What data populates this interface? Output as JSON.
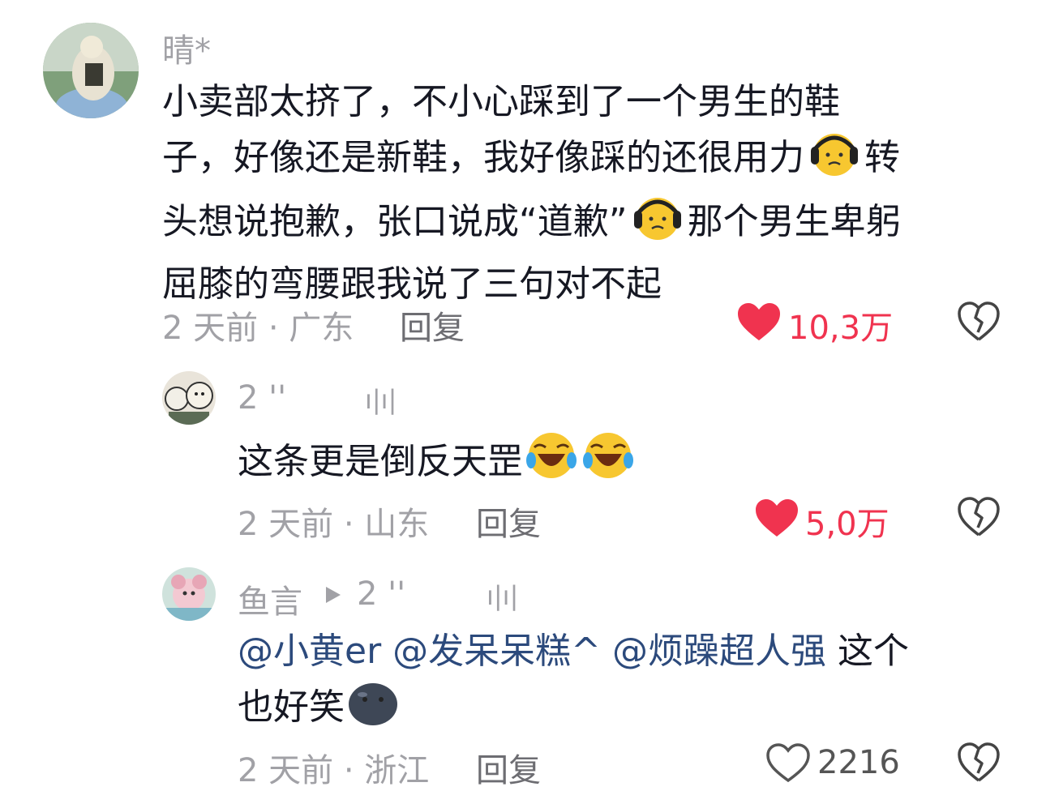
{
  "colors": {
    "like_active": "#f0334f",
    "meta": "#a1a1a6",
    "mention": "#2c4a7c",
    "text": "#161823"
  },
  "comment1": {
    "username": "晴*",
    "lines": [
      "小卖部太挤了，不小心踩到了一个男生的鞋",
      "子，好像还是新鞋，我好像踩的还很用力",
      "转",
      "头想说抱歉，张口说成“道歉”",
      "那个男生卑躬",
      "屈膝的弯腰跟我说了三句对不起"
    ],
    "meta": "2 天前 · 广东",
    "reply": "回复",
    "likes": "10,3万",
    "liked": true
  },
  "comment2": {
    "username": "2 ''",
    "author_tag": "ı|ı|",
    "text": "这条更是倒反天罡",
    "meta": "2 天前 · 山东",
    "reply": "回复",
    "likes": "5,0万",
    "liked": true
  },
  "comment3": {
    "username": "鱼言",
    "reply_to": "2 ''",
    "author_tag": "ı|ı|",
    "mentions": [
      "@小黄er",
      "@发呆呆糕^",
      "@烦躁超人强"
    ],
    "text_line1_tail": "这个",
    "text_line2": "也好笑",
    "meta": "2 天前 · 浙江",
    "reply": "回复",
    "likes": "2216",
    "liked": false
  },
  "icons": [
    "heart-icon",
    "dislike-icon",
    "triangle-arrow-icon",
    "headphone-face-emoji",
    "laugh-cry-emoji",
    "dark-blob-emoji"
  ]
}
